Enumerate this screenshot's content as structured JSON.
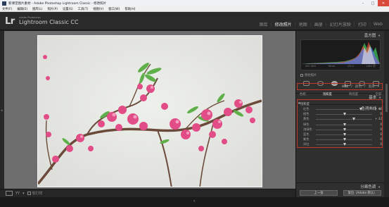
{
  "window": {
    "title": "新课堂图片素材 - Adobe Photoshop Lightroom Classic - 修改照片"
  },
  "menu": {
    "items": [
      "文件(F)",
      "编辑(E)",
      "图库(L)",
      "照片(P)",
      "设置(S)",
      "工具(T)",
      "视图(V)",
      "窗口(W)",
      "帮助(H)"
    ]
  },
  "header": {
    "logo_text": "Lr",
    "brand_small": "Adobe Photoshop",
    "brand_big": "Lightroom Classic CC"
  },
  "modules": [
    {
      "label": "图库",
      "active": false
    },
    {
      "label": "修改照片",
      "active": true
    },
    {
      "label": "地图",
      "active": false
    },
    {
      "label": "画册",
      "active": false
    },
    {
      "label": "幻灯片放映",
      "active": false
    },
    {
      "label": "打印",
      "active": false
    },
    {
      "label": "Web",
      "active": false
    }
  ],
  "histogram": {
    "panel_title": "直方图",
    "readout": [
      "ISO 400",
      "9mm",
      "f/5.0",
      "1/80 秒"
    ],
    "original_photo_label": "原始照片",
    "colors": {
      "red": "#e0433b",
      "green": "#3fbf5a",
      "blue": "#4c7be8",
      "white": "#e8e8e8"
    }
  },
  "panels": {
    "basic": "基本",
    "tone_curve": "色调曲线",
    "hsl_tabs": [
      "HSL",
      "颜色",
      "黑白"
    ],
    "hsl_selected": "HSL",
    "subtabs": [
      "色相",
      "饱和度",
      "明亮度",
      "全部"
    ],
    "subtab_selected": "饱和度",
    "hsl_heading": "饱和度",
    "split_toning": "分离色调"
  },
  "sliders": [
    {
      "label": "红色",
      "value": "+ 46",
      "level": 0.79
    },
    {
      "label": "橙色",
      "value": "0",
      "level": 0.5
    },
    {
      "label": "黄色",
      "value": "+ 32",
      "level": 0.66
    },
    {
      "label": "绿色",
      "value": "0",
      "level": 0.5
    },
    {
      "label": "浅绿色",
      "value": "0",
      "level": 0.5
    },
    {
      "label": "蓝色",
      "value": "0",
      "level": 0.5
    },
    {
      "label": "紫色",
      "value": "0",
      "level": 0.5
    },
    {
      "label": "洋红",
      "value": "0",
      "level": 0.5
    }
  ],
  "buttons": {
    "previous": "上一张",
    "reset": "复位（Adobe 默认）"
  },
  "toolbar": {
    "soft_proof_label": "软打样"
  },
  "icons": {
    "view_mode": "loupe-view-icon",
    "before_after": "before-after-icon",
    "scroll_up": "triangle-left-icon"
  }
}
